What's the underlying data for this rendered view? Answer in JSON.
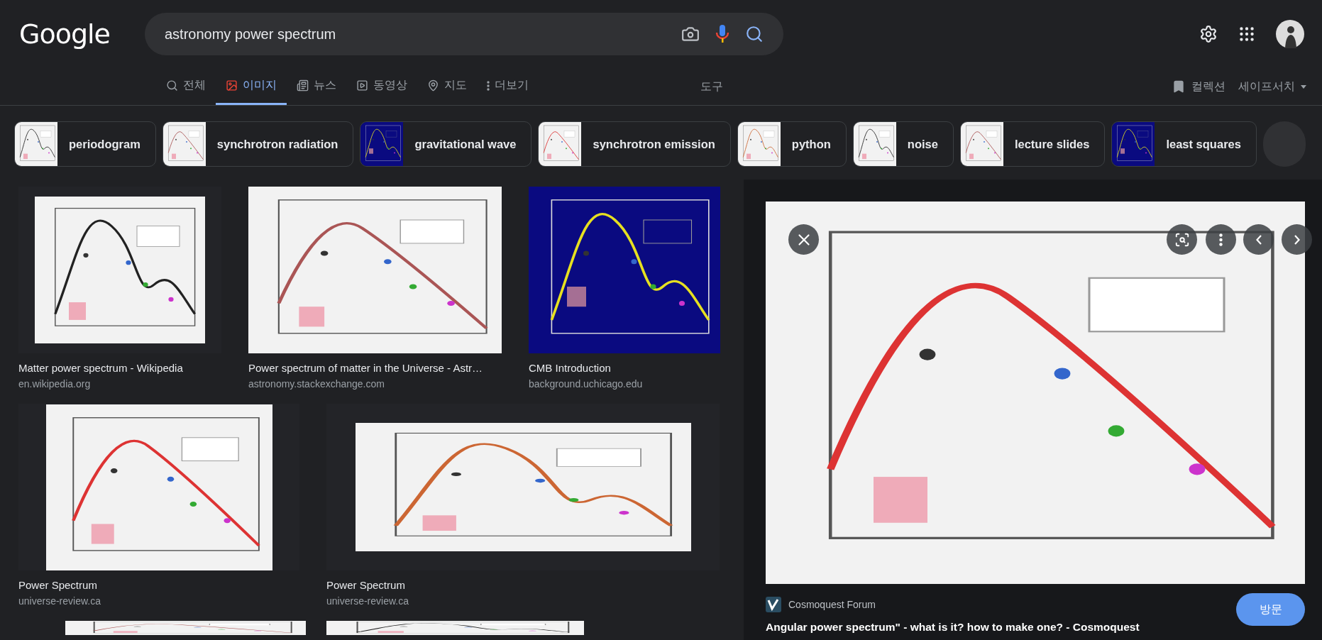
{
  "header": {
    "logo": "Google",
    "search": {
      "value": "astronomy power spectrum"
    }
  },
  "tabs": [
    {
      "kind": "all",
      "label": "전체",
      "selected": false
    },
    {
      "kind": "images",
      "label": "이미지",
      "selected": true
    },
    {
      "kind": "news",
      "label": "뉴스",
      "selected": false
    },
    {
      "kind": "videos",
      "label": "동영상",
      "selected": false
    },
    {
      "kind": "maps",
      "label": "지도",
      "selected": false
    },
    {
      "kind": "more",
      "label": "더보기",
      "selected": false
    }
  ],
  "tools": "도구",
  "collections": "컬렉션",
  "safesearch": "세이프서치",
  "chips": [
    "periodogram",
    "synchrotron radiation",
    "gravitational wave",
    "synchrotron emission",
    "python",
    "noise",
    "lecture slides",
    "least squares"
  ],
  "results": [
    [
      {
        "title": "Matter power spectrum - Wikipedia",
        "source": "en.wikipedia.org"
      },
      {
        "title": "Power spectrum of matter in the Universe - Astr…",
        "source": "astronomy.stackexchange.com"
      },
      {
        "title": "CMB Introduction",
        "source": "background.uchicago.edu"
      }
    ],
    [
      {
        "title": "Power Spectrum",
        "source": "universe-review.ca"
      },
      {
        "title": "Power Spectrum",
        "source": "universe-review.ca"
      }
    ],
    [
      {
        "kind": "picture"
      },
      {
        "kind": "picture"
      }
    ]
  ],
  "preview": {
    "source": "Cosmoquest Forum",
    "title": "Angular power spectrum\" - what is it? how to make one? - Cosmoquest",
    "visit": "방문"
  }
}
